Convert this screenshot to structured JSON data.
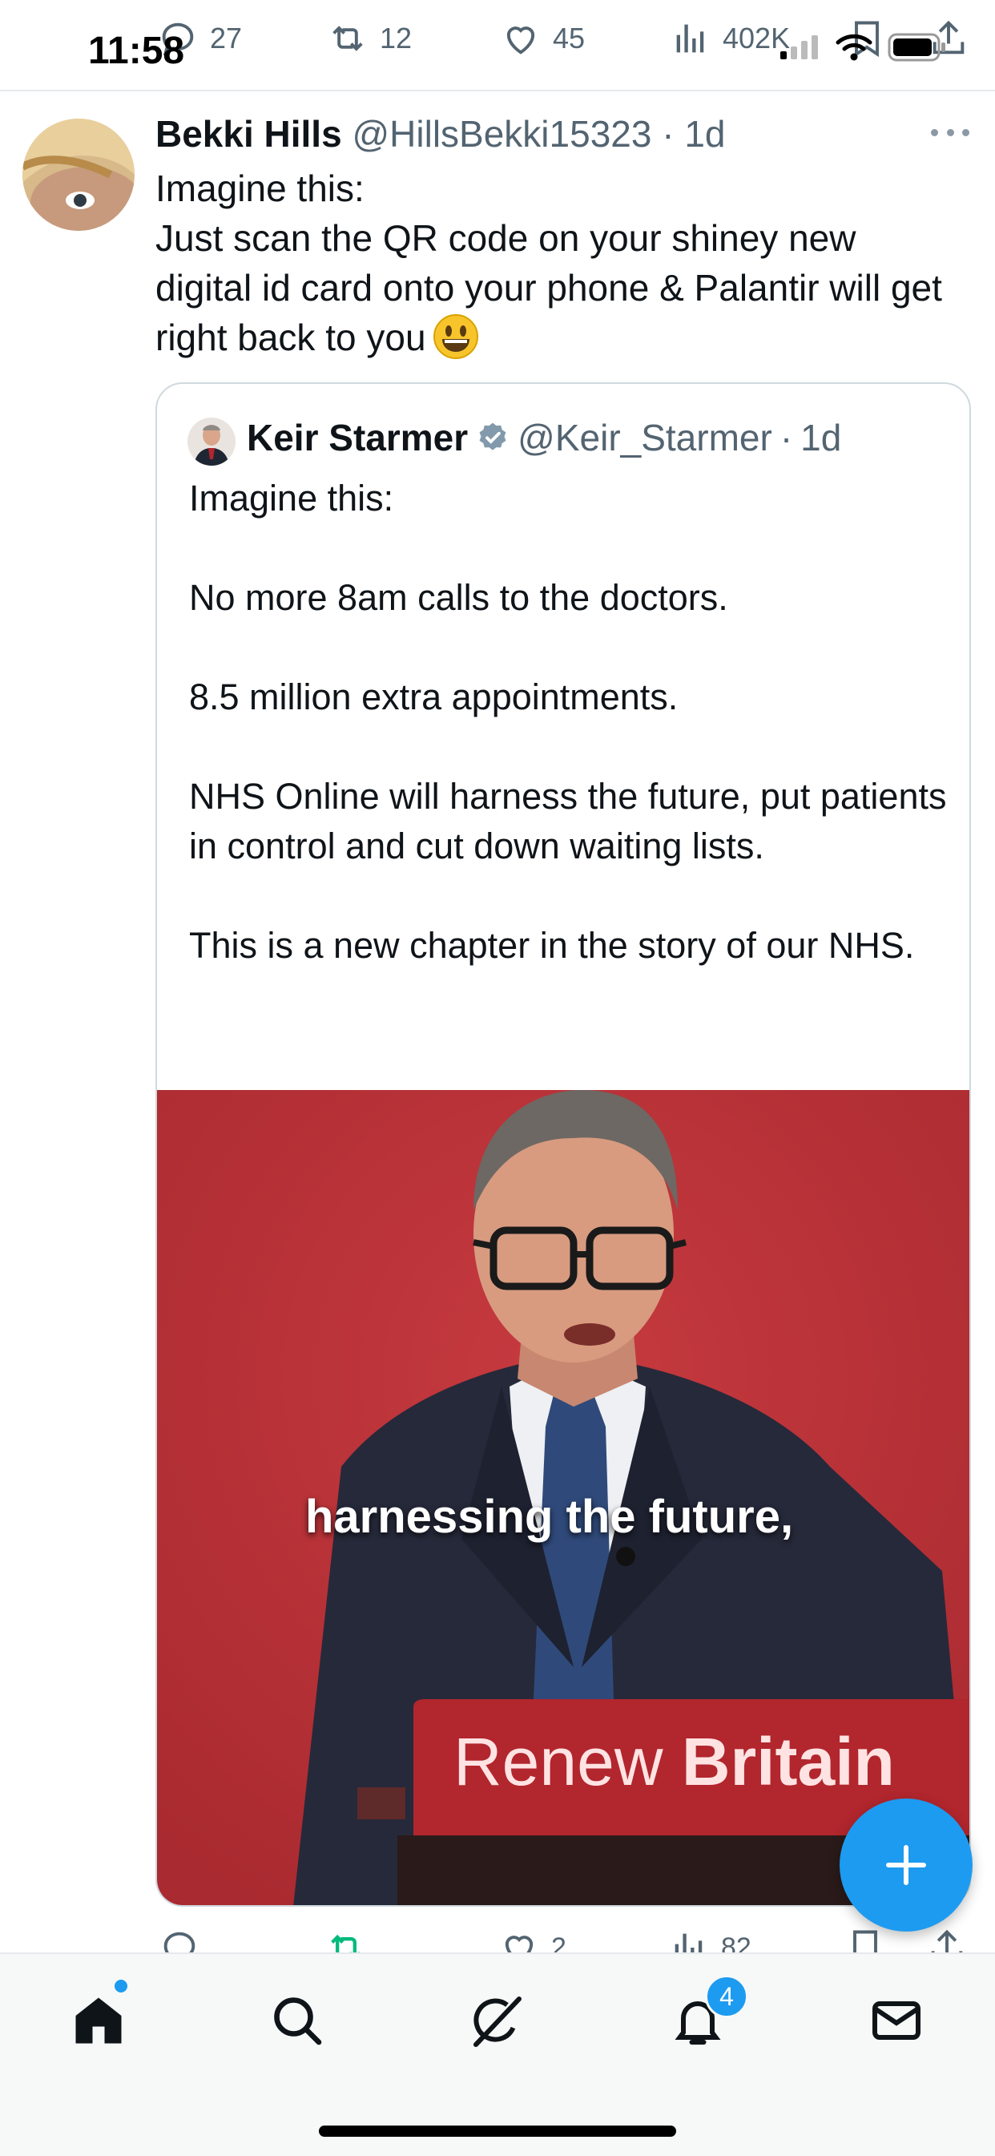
{
  "status_bar": {
    "time": "11:58"
  },
  "top_actions": {
    "replies": "27",
    "reposts": "12",
    "likes": "45",
    "views": "402K"
  },
  "tweet": {
    "author_name": "Bekki Hills",
    "handle": "@HillsBekki15323",
    "age": "1d",
    "text": "Imagine this:\nJust scan the QR code on your shiney new digital id card onto your phone & Palantir will get right back to you",
    "emoji": "grinning-face"
  },
  "quote": {
    "author_name": "Keir Starmer",
    "verified": true,
    "handle": "@Keir_Starmer",
    "age": "1d",
    "text": "Imagine this:\n\nNo more 8am calls to the doctors.\n\n8.5 million extra appointments.\n\nNHS Online will harness the future, put patients in control and cut down waiting lists.\n\nThis is a new chapter in the story of our NHS.",
    "media": {
      "lectern_sign_light": "Renew ",
      "lectern_sign_bold": "Britain",
      "caption": "harnessing the future,"
    }
  },
  "bottom_actions": {
    "likes": "2",
    "views": "82"
  },
  "bottom_nav": {
    "items": [
      "home-icon",
      "search-icon",
      "grok-icon",
      "notifications-icon",
      "messages-icon"
    ],
    "notification_badge": "4"
  },
  "colors": {
    "accent": "#1d9bf0",
    "repost_active": "#00ba7c",
    "muted": "#536471",
    "podium_red": "#c8323a"
  }
}
